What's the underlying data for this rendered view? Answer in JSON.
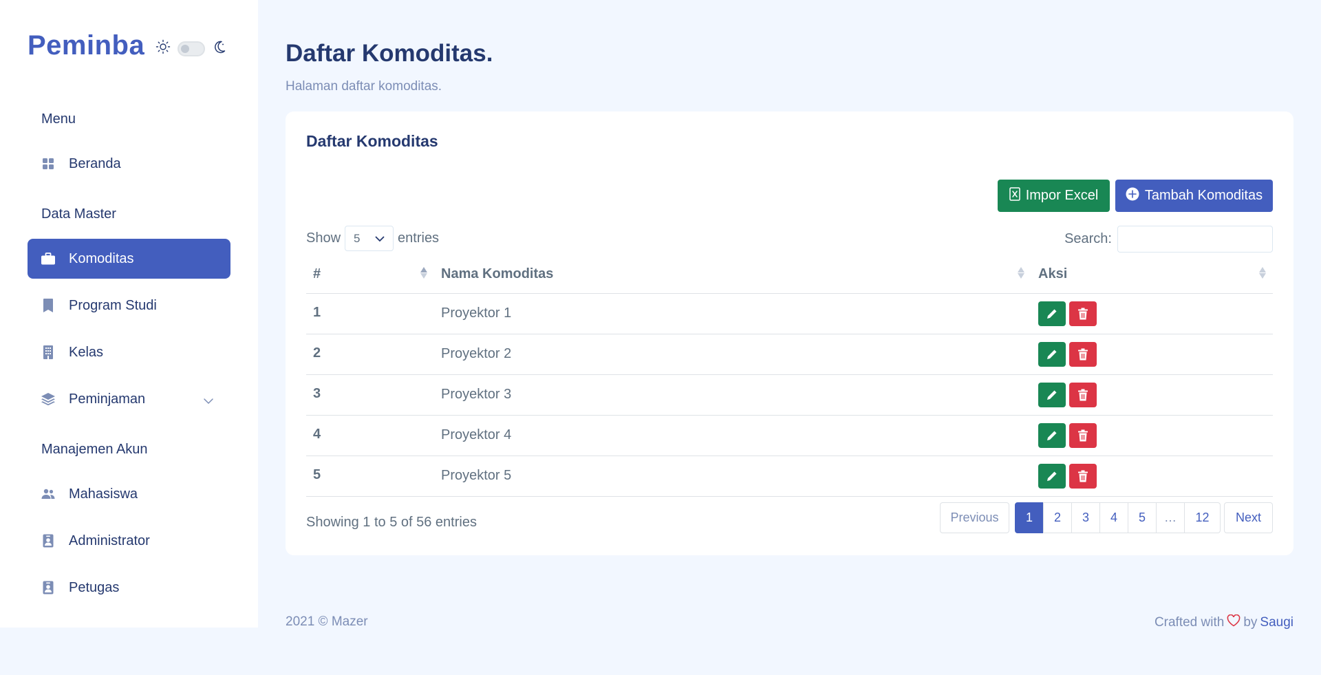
{
  "sidebar": {
    "brand": "Peminba",
    "sections": [
      {
        "title": "Menu"
      },
      {
        "title": "Data Master"
      },
      {
        "title": "Manajemen Akun"
      }
    ],
    "items": [
      {
        "label": "Beranda",
        "icon": "grid-icon"
      },
      {
        "label": "Komoditas",
        "icon": "briefcase-icon",
        "active": true
      },
      {
        "label": "Program Studi",
        "icon": "bookmark-icon"
      },
      {
        "label": "Kelas",
        "icon": "building-icon"
      },
      {
        "label": "Peminjaman",
        "icon": "layers-icon",
        "has_submenu": true
      },
      {
        "label": "Mahasiswa",
        "icon": "people-icon"
      },
      {
        "label": "Administrator",
        "icon": "person-badge-icon"
      },
      {
        "label": "Petugas",
        "icon": "person-badge-icon"
      }
    ]
  },
  "header": {
    "title": "Daftar Komoditas.",
    "subtitle": "Halaman daftar komoditas."
  },
  "card": {
    "title": "Daftar Komoditas",
    "import_label": "Impor Excel",
    "add_label": "Tambah Komoditas",
    "show_label": "Show",
    "entries_label": "entries",
    "page_length": "5",
    "search_label": "Search:",
    "search_value": "",
    "columns": [
      "#",
      "Nama Komoditas",
      "Aksi"
    ],
    "rows": [
      {
        "no": "1",
        "name": "Proyektor 1"
      },
      {
        "no": "2",
        "name": "Proyektor 2"
      },
      {
        "no": "3",
        "name": "Proyektor 3"
      },
      {
        "no": "4",
        "name": "Proyektor 4"
      },
      {
        "no": "5",
        "name": "Proyektor 5"
      }
    ],
    "info": "Showing 1 to 5 of 56 entries",
    "pagination": {
      "previous": "Previous",
      "pages": [
        "1",
        "2",
        "3",
        "4",
        "5",
        "…",
        "12"
      ],
      "next": "Next",
      "current": "1"
    }
  },
  "footer": {
    "left": "2021 © Mazer",
    "crafted": "Crafted with",
    "by": "by",
    "author": "Saugi"
  },
  "colors": {
    "primary": "#435ebe",
    "success": "#198754",
    "danger": "#dc3545",
    "background": "#f2f7ff"
  }
}
